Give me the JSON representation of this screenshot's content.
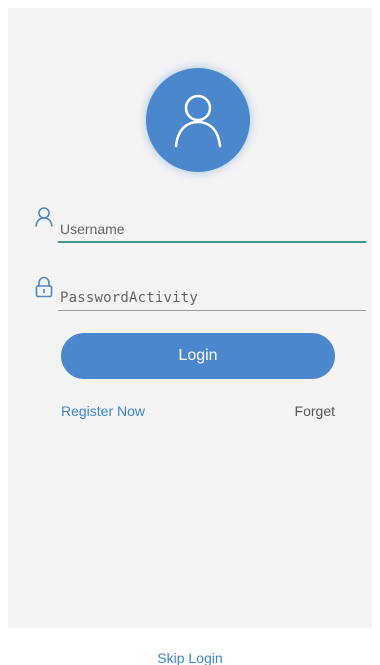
{
  "avatar": {
    "icon": "user-avatar-icon",
    "color": "#4a87cd"
  },
  "username": {
    "placeholder": "Username",
    "value": "",
    "icon": "user-icon"
  },
  "password": {
    "placeholder": "PasswordActivity",
    "value": "",
    "icon": "lock-icon"
  },
  "login_label": "Login",
  "register_label": "Register Now",
  "forget_label": "Forget",
  "skip_label": "Skip Login",
  "colors": {
    "accent": "#4a87cd",
    "input_focus_underline": "#3a9a8c",
    "panel_bg": "#f4f4f5",
    "link_blue": "#3f84d0"
  }
}
